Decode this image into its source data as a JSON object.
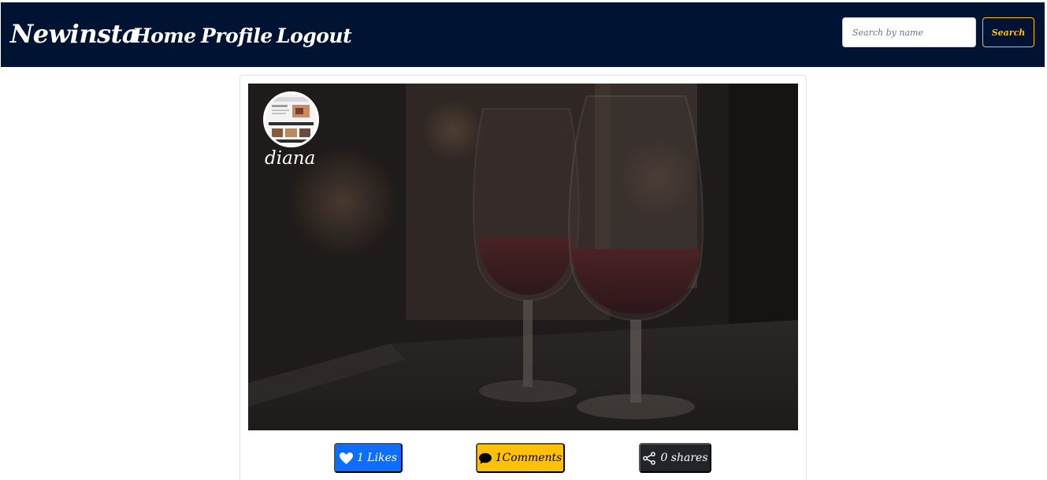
{
  "navbar": {
    "brand": "Newinsta",
    "links": [
      {
        "label": "Home"
      },
      {
        "label": "Profile"
      },
      {
        "label": "Logout"
      }
    ],
    "search": {
      "placeholder": "Search by name",
      "value": "",
      "button_label": "Search"
    },
    "background_color": "#001333",
    "accent_color": "#ffc107"
  },
  "post": {
    "username": "diana",
    "avatar_icon": "avatar-thumbnail",
    "image_description_icon": "wine-glasses-photo",
    "actions": {
      "likes": {
        "label": "1 Likes",
        "icon": "heart-icon",
        "color": "#0d6efd"
      },
      "comments": {
        "label": "1Comments",
        "icon": "chat-bubble-icon",
        "color": "#ffc107"
      },
      "shares": {
        "label": "0 shares",
        "icon": "share-icon",
        "color": "#212529"
      }
    }
  }
}
